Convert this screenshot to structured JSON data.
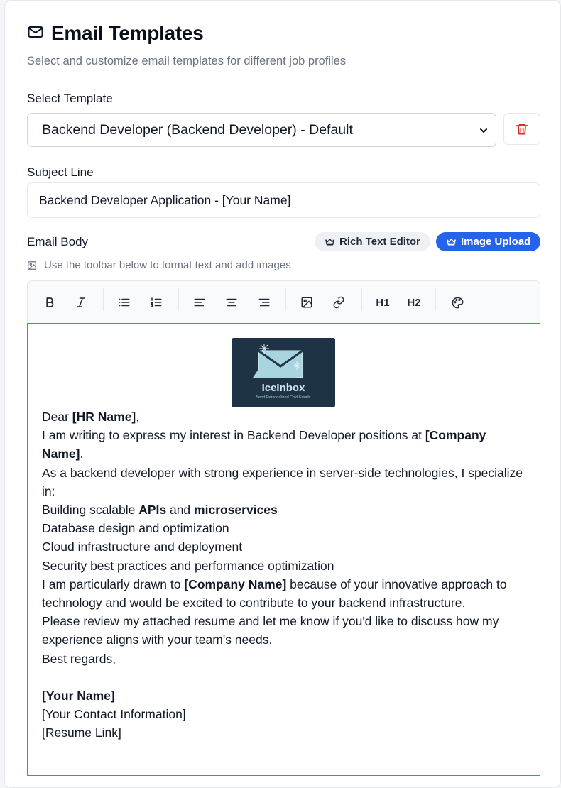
{
  "header": {
    "title": "Email Templates",
    "subtitle": "Select and customize email templates for different job profiles"
  },
  "template": {
    "label": "Select Template",
    "selected": "Backend Developer (Backend Developer) - Default"
  },
  "subject": {
    "label": "Subject Line",
    "value": "Backend Developer Application - [Your Name]"
  },
  "body_section": {
    "label": "Email Body",
    "rich_text_label": "Rich Text Editor",
    "image_upload_label": "Image Upload",
    "hint": "Use the toolbar below to format text and add images"
  },
  "toolbar": {
    "h1": "H1",
    "h2": "H2",
    "icons": [
      "bold-icon",
      "italic-icon",
      "bullet-list-icon",
      "numbered-list-icon",
      "align-left-icon",
      "align-center-icon",
      "align-right-icon",
      "image-icon",
      "link-icon",
      "palette-icon"
    ]
  },
  "logo": {
    "name": "IceInbox",
    "tagline": "Send Personalized Cold Emails"
  },
  "email": {
    "dear": "Dear ",
    "hr_name": "[HR Name]",
    "comma": ",",
    "l2a": "I am writing to express my interest in Backend Developer positions at ",
    "company": "[Company Name]",
    "period": ".",
    "l3": "As a backend developer with strong experience in server-side technologies, I specialize in:",
    "l4a": "Building scalable ",
    "apis": "APIs",
    "and": " and ",
    "microservices": "microservices",
    "l5": "Database design and optimization",
    "l6": "Cloud infrastructure and deployment",
    "l7": "Security best practices and performance optimization",
    "l8a": "I am particularly drawn to ",
    "l8b": " because of your innovative approach to technology and would be excited to contribute to your backend infrastructure.",
    "l9": "Please review my attached resume and let me know if you'd like to discuss how my experience aligns with your team's needs.",
    "l10": "Best regards,",
    "your_name": "[Your Name]",
    "contact": "[Your Contact Information]",
    "resume": "[Resume Link]"
  },
  "colors": {
    "accent": "#2563eb",
    "danger": "#dc2626",
    "editor_border": "#3b82f6"
  }
}
